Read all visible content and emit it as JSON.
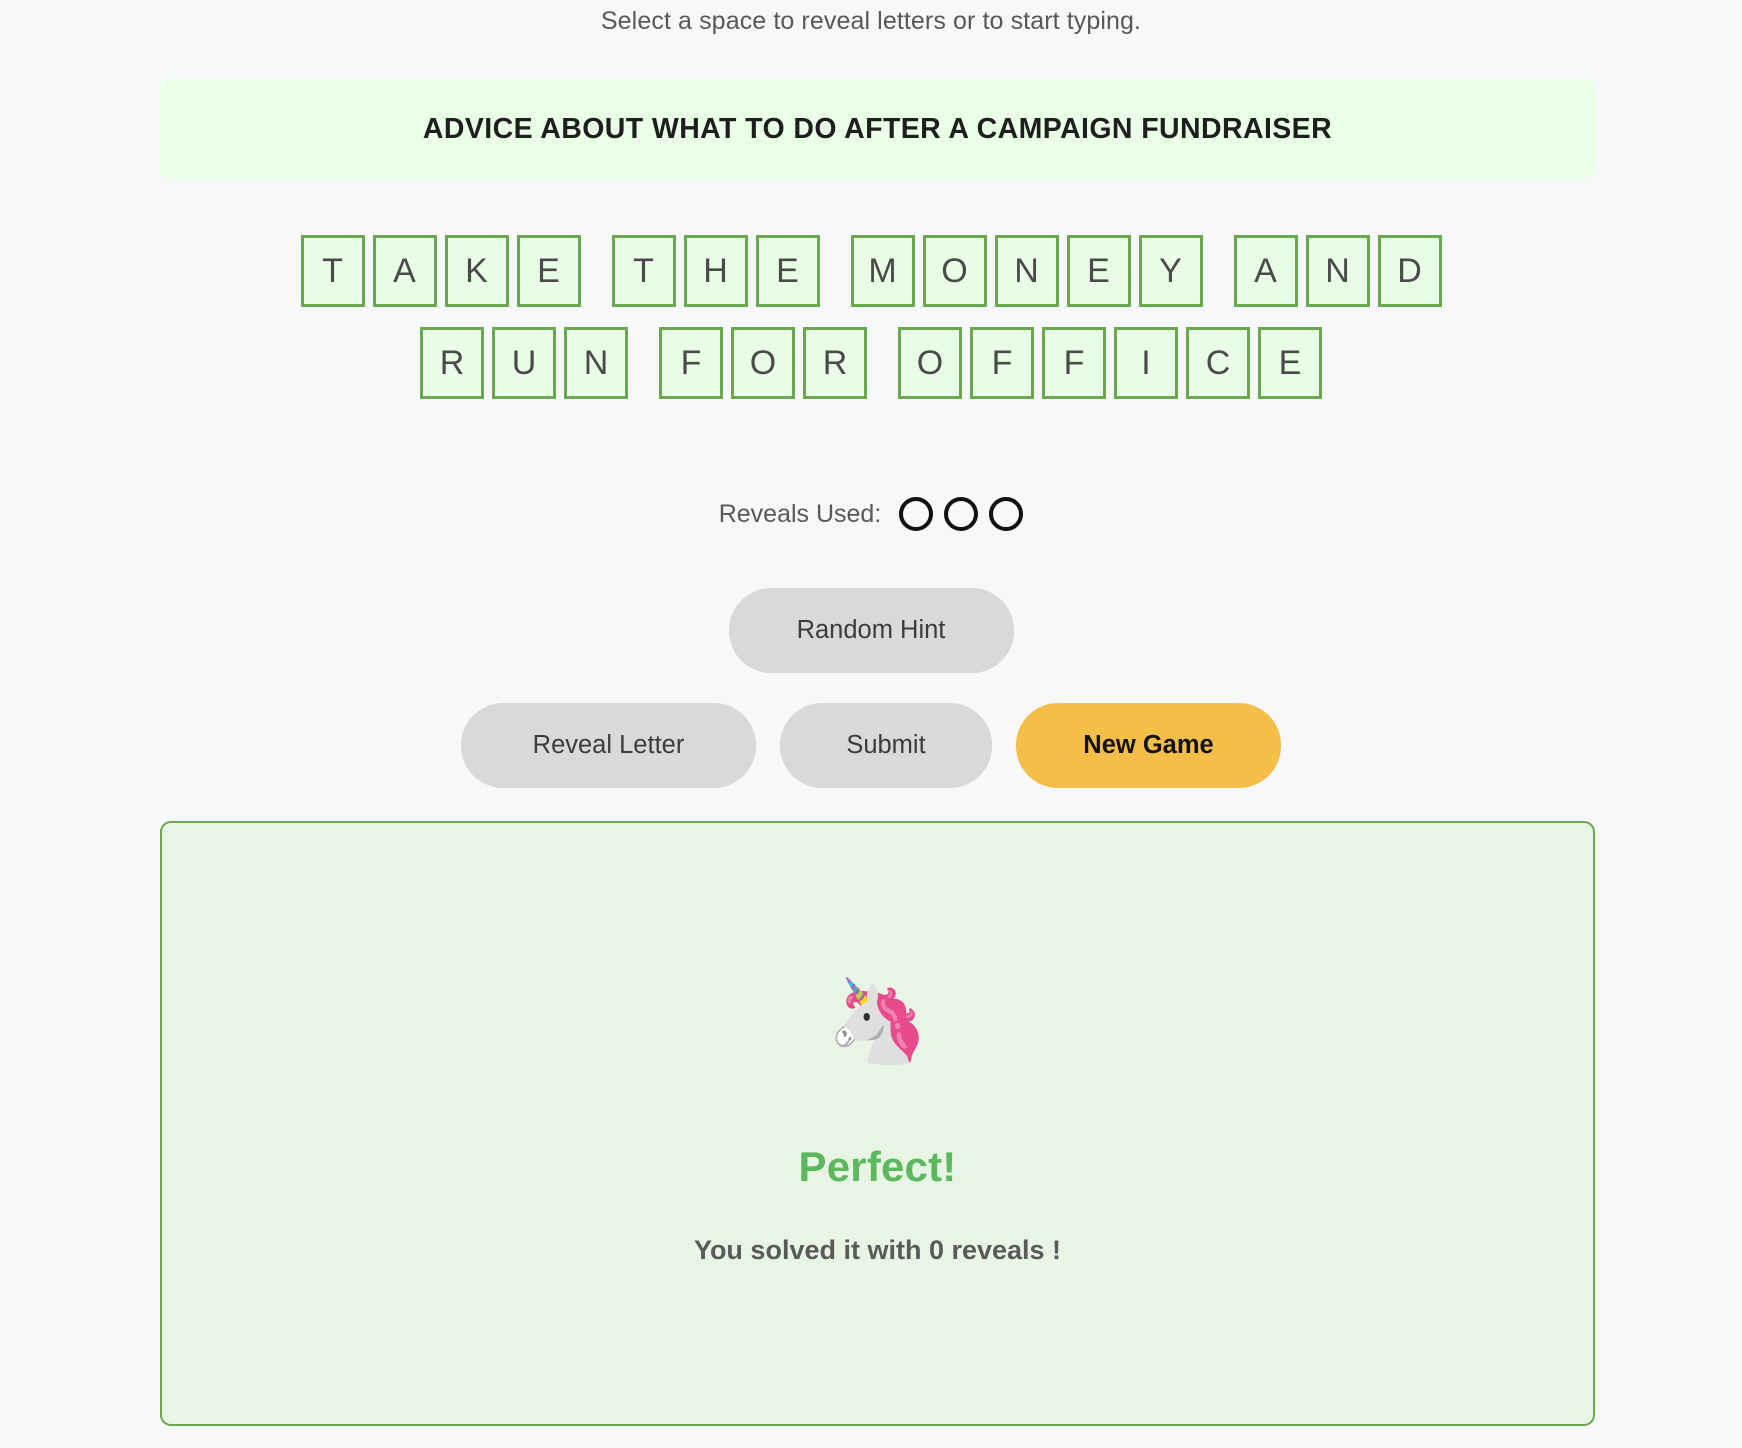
{
  "instruction": "Select a space to reveal letters or to start typing.",
  "clue": {
    "text": "ADVICE ABOUT WHAT TO DO AFTER A CAMPAIGN FUNDRAISER",
    "background_color": "#e9ffe6"
  },
  "answer": {
    "solution": "TAKE THE MONEY AND RUN FOR OFFICE",
    "tile_border_color": "#6aa84f",
    "tile_background_color": "#e9fce6",
    "rows": [
      {
        "words": [
          {
            "letters": [
              "T",
              "A",
              "K",
              "E"
            ]
          },
          {
            "letters": [
              "T",
              "H",
              "E"
            ]
          },
          {
            "letters": [
              "M",
              "O",
              "N",
              "E",
              "Y"
            ]
          },
          {
            "letters": [
              "A",
              "N",
              "D"
            ]
          }
        ]
      },
      {
        "words": [
          {
            "letters": [
              "R",
              "U",
              "N"
            ]
          },
          {
            "letters": [
              "F",
              "O",
              "R"
            ]
          },
          {
            "letters": [
              "O",
              "F",
              "F",
              "I",
              "C",
              "E"
            ]
          }
        ]
      }
    ]
  },
  "reveals": {
    "label": "Reveals Used:",
    "total": 3,
    "used": 0,
    "dots": [
      false,
      false,
      false
    ]
  },
  "buttons": {
    "random_hint": "Random Hint",
    "reveal_letter": "Reveal Letter",
    "submit": "Submit",
    "new_game": "New Game",
    "new_game_color": "#f5be49",
    "grey_color": "#d9d9d9"
  },
  "result": {
    "emoji": "🦄",
    "emoji_name": "unicorn-emoji",
    "title": "Perfect!",
    "title_color": "#5cb85c",
    "subtitle": "You solved it with 0 reveals !",
    "background_color": "#e8f5e4",
    "border_color": "#6aa84f"
  }
}
